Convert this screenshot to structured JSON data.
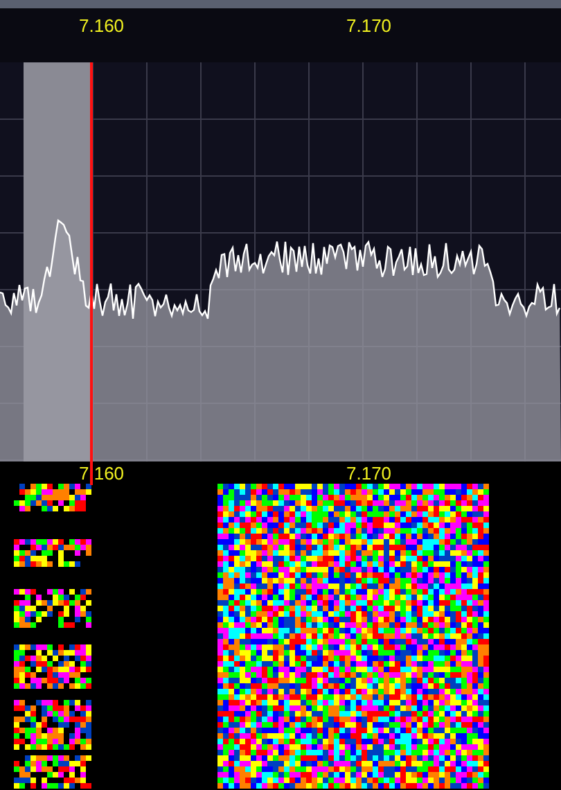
{
  "frequency_scale": {
    "labels": [
      "7.160",
      "7.170"
    ]
  },
  "waterfall": {
    "labels": [
      "7.160",
      "7.170"
    ]
  }
}
